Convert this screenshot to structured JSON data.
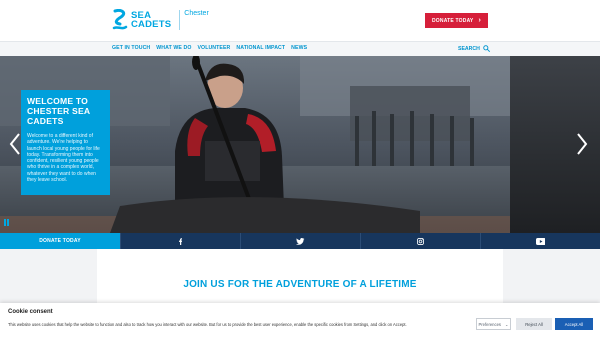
{
  "header": {
    "logo_line1": "SEA",
    "logo_line2": "CADETS",
    "unit_name": "Chester",
    "donate_button": "DONATE TODAY"
  },
  "nav": {
    "items": [
      "GET IN TOUCH",
      "WHAT WE DO",
      "VOLUNTEER",
      "NATIONAL IMPACT",
      "NEWS"
    ],
    "search_label": "SEARCH"
  },
  "hero": {
    "title": "WELCOME TO CHESTER SEA CADETS",
    "body": "Welcome to a different kind of adventure. We're helping to launch local young people for life today. Transforming them into confident, resilient young people who thrive in a complex world, whatever they want to do when they leave school."
  },
  "social_bar": {
    "donate_label": "DONATE TODAY",
    "icons": [
      "facebook-icon",
      "twitter-icon",
      "instagram-icon",
      "youtube-icon"
    ]
  },
  "content": {
    "heading": "JOIN US FOR THE ADVENTURE OF A LIFETIME"
  },
  "cookie_banner": {
    "title": "Cookie consent",
    "text": "This website uses cookies that help the website to function and also to track how you interact with our website. But for us to provide the best user experience, enable the specific cookies from Settings, and click on Accept.",
    "preferences_label": "Preferences",
    "reject_label": "Reject All",
    "accept_label": "Accept All"
  },
  "colors": {
    "brand_blue": "#00a0dc",
    "donate_red": "#d61f3a",
    "navy": "#17365d",
    "accept_blue": "#1a5fb4"
  }
}
